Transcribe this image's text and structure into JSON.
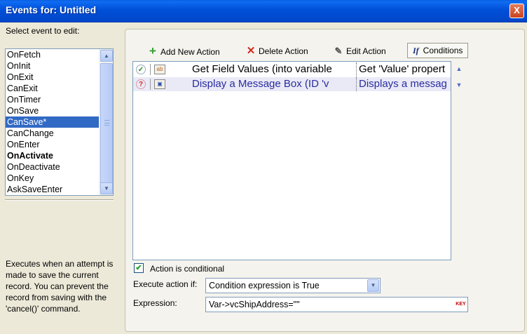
{
  "window": {
    "title": "Events for:  Untitled",
    "close_label": "X"
  },
  "events": {
    "heading": "Select event to edit:",
    "items": [
      {
        "label": "OnFetch"
      },
      {
        "label": "OnInit"
      },
      {
        "label": "OnExit"
      },
      {
        "label": "CanExit"
      },
      {
        "label": "OnTimer"
      },
      {
        "label": "OnSave"
      },
      {
        "label": "CanSave*"
      },
      {
        "label": "CanChange"
      },
      {
        "label": "OnEnter"
      },
      {
        "label": "OnActivate"
      },
      {
        "label": "OnDeactivate"
      },
      {
        "label": "OnKey"
      },
      {
        "label": "AskSaveEnter"
      }
    ],
    "selected": "CanSave*",
    "bold": "OnActivate",
    "description": "Executes when an attempt is made to save the current record. You can prevent the record from saving with the 'cancel()' command."
  },
  "toolbar": {
    "add_label": "Add New Action",
    "delete_label": "Delete Action",
    "edit_label": "Edit Action",
    "conditions_label": "Conditions",
    "conditions_icon_text": "If"
  },
  "actions": [
    {
      "status": "ok",
      "name": "Get Field Values (into variable",
      "description": "Get 'Value' propert",
      "color": "#000000"
    },
    {
      "status": "conditional",
      "name": "Display a Message Box (ID 'v",
      "description": "Displays a messag",
      "color": "#2B2BA0"
    }
  ],
  "condition": {
    "checkbox_label": "Action is conditional",
    "checked": true,
    "execute_label": "Execute action if:",
    "execute_value": "Condition expression is True",
    "expression_label": "Expression:",
    "expression_value": "Var->vcShipAddress=\"\"",
    "expression_button": "KEY"
  },
  "colors": {
    "titlebar": "#0050D8",
    "selection": "#316AC5",
    "window_bg": "#ECE9D8"
  }
}
